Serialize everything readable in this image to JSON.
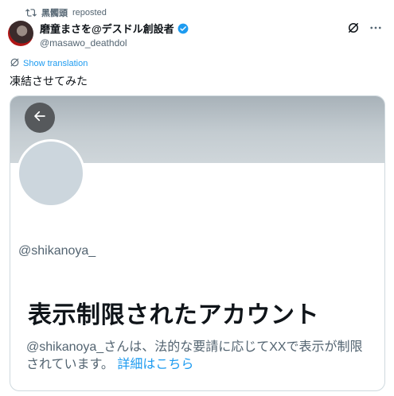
{
  "repost": {
    "by": "黑髑頭",
    "label": "reposted"
  },
  "author": {
    "name": "磨童まさを@デスドル創設者",
    "handle": "@masawo_deathdol"
  },
  "translate_link": "Show translation",
  "post_text": "凍結させてみた",
  "card": {
    "handle": "@shikanoya_",
    "title": "表示制限されたアカウント",
    "description": "@shikanoya_さんは、法的な要請に応じてXXで表示が制限されています。",
    "link": "詳細はこちら"
  },
  "colors": {
    "accent": "#1d9bf0",
    "secondary_text": "#536471",
    "banner": "#b6bfc5"
  }
}
